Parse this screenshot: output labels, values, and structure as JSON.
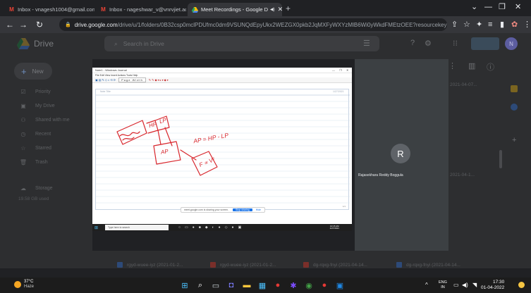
{
  "browser": {
    "tabs": [
      {
        "title": "Inbox - vnagesh1004@gmail.con",
        "favicon": "gmail-icon",
        "active": false
      },
      {
        "title": "Inbox - nageshwar_v@vnrvjiet.ac",
        "favicon": "gmail-icon",
        "active": false
      },
      {
        "title": "Meet Recordings - Google D",
        "favicon": "drive-icon",
        "active": true
      }
    ],
    "address": {
      "host": "drive.google.com",
      "path": "/drive/u/1/folders/0B32csp0mclPDUfmc0dm9VSUNQdEpyUkx2WEZGX0pkb2JqMXFyWXYzMlB6Wi0yWkdFMEtzOEE?resourcekey=0-r5aj1ntP..."
    }
  },
  "drive": {
    "title": "Drive",
    "search_placeholder": "Search in Drive",
    "avatar_letter": "N",
    "new_label": "New",
    "nav": [
      {
        "label": "Priority",
        "icon": "priority-icon"
      },
      {
        "label": "My Drive",
        "icon": "my-drive-icon"
      },
      {
        "label": "Shared with me",
        "icon": "shared-icon"
      },
      {
        "label": "Recent",
        "icon": "recent-icon"
      },
      {
        "label": "Starred",
        "icon": "star-icon"
      },
      {
        "label": "Trash",
        "icon": "trash-icon"
      },
      {
        "label": "Storage",
        "icon": "cloud-icon"
      }
    ],
    "storage_used": "19.58 GB used",
    "side_dates": [
      "2021-04-07...",
      "2021-04-1..."
    ],
    "files": [
      {
        "name": "rgyd-wuee-iyz (2021-01-2...",
        "color": "#4285f4"
      },
      {
        "name": "rgyd-wuee-iyz (2021-01-2...",
        "color": "#ea4335"
      },
      {
        "name": "dg-rqxg-fnyi (2021-04-14...",
        "color": "#ea4335"
      },
      {
        "name": "dg-rqxg-fnyi (2021-04-14...",
        "color": "#4285f4"
      }
    ]
  },
  "meet": {
    "participant_letter": "R",
    "participant_name": "Rajasekhara Reddy Boggula",
    "journal": {
      "title": "Note1 - Windows Journal",
      "menu": "File  Edit  View  Insert  Actions  Tools  Help",
      "page_width_label": "Page Width",
      "note_title": "Note Title",
      "note_date": "1/27/2021",
      "page_number": "1/1",
      "notice_text": "meet.google.com is sharing your screen.",
      "stop_label": "Stop sharing",
      "hide_label": "Hide",
      "taskbar_search": "Type here to search",
      "time": "10:15 AM",
      "date": "1/27/2021",
      "handwriting": [
        "HP",
        "LP",
        "AP",
        "AP = HP - LP",
        "F ∝ V²"
      ]
    }
  },
  "taskbar": {
    "temperature": "37°C",
    "condition": "Haze",
    "lang_top": "ENG",
    "lang_bottom": "IN",
    "time": "17:30",
    "date": "01-04-2022"
  }
}
